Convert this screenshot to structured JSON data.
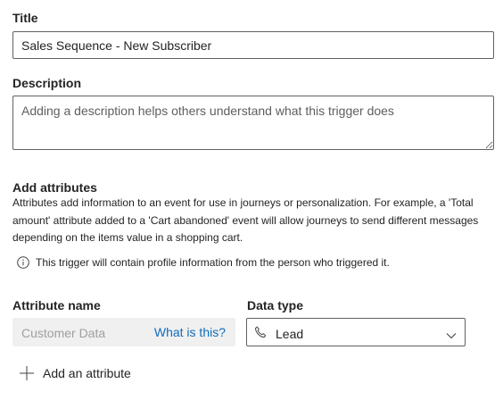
{
  "form": {
    "title_label": "Title",
    "title_value": "Sales Sequence - New Subscriber",
    "description_label": "Description",
    "description_placeholder": "Adding a description helps others understand what this trigger does"
  },
  "attributes": {
    "section_title": "Add attributes",
    "description_lines": [
      "Attributes add information to an event for use in journeys or personalization. For example, a 'Total",
      "amount' attribute added to a 'Cart abandoned' event will allow journeys to send different messages",
      "depending on the items value in a shopping cart."
    ],
    "info_text": "This trigger will contain profile information from the person who triggered it.",
    "info_icon": "info-circle-icon",
    "attribute_name_label": "Attribute name",
    "data_type_label": "Data type",
    "attribute_name_placeholder": "Customer Data",
    "what_is_this_link": "What is this?",
    "data_type_value": "Lead",
    "data_type_icon": "phone-icon",
    "add_attribute_label": "Add an attribute"
  },
  "colors": {
    "link": "#0f6cbd",
    "border": "#616161",
    "disabled_bg": "#f0f0f0"
  }
}
